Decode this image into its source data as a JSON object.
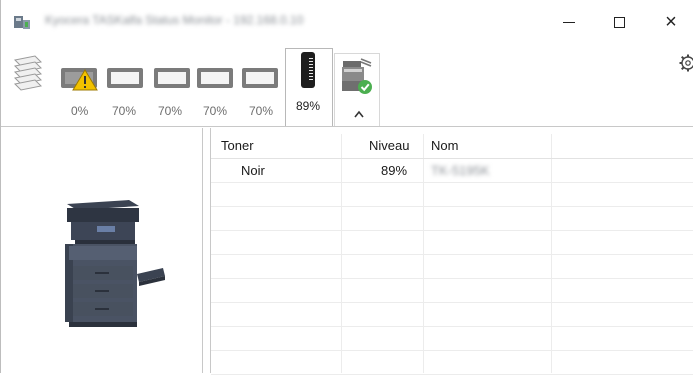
{
  "window": {
    "title": "Kyocera TASKalfa Status Monitor - 192.168.0.10",
    "minimize_symbol": "",
    "maximize_symbol": "",
    "close_symbol": "×"
  },
  "toolbar": {
    "paper_trays": [
      {
        "label": "0%",
        "warning": true
      },
      {
        "label": "70%",
        "warning": false
      },
      {
        "label": "70%",
        "warning": false
      },
      {
        "label": "70%",
        "warning": false
      },
      {
        "label": "70%",
        "warning": false
      }
    ],
    "toner_label": "89%",
    "active_tab": "toner",
    "icons": {
      "stack": "paper-stack-icon",
      "toner": "toner-cartridge-icon",
      "status": "printer-status-icon",
      "collapse": "chevron-up-icon",
      "settings": "gear-icon"
    }
  },
  "table": {
    "columns": [
      "Toner",
      "Niveau",
      "Nom"
    ],
    "rows": [
      {
        "toner": "Noir",
        "level": "89%",
        "name": "TK-5195K"
      }
    ]
  },
  "colors": {
    "warning": "#f2c200",
    "status_ok": "#4caf50",
    "border": "#c8c8c8"
  }
}
